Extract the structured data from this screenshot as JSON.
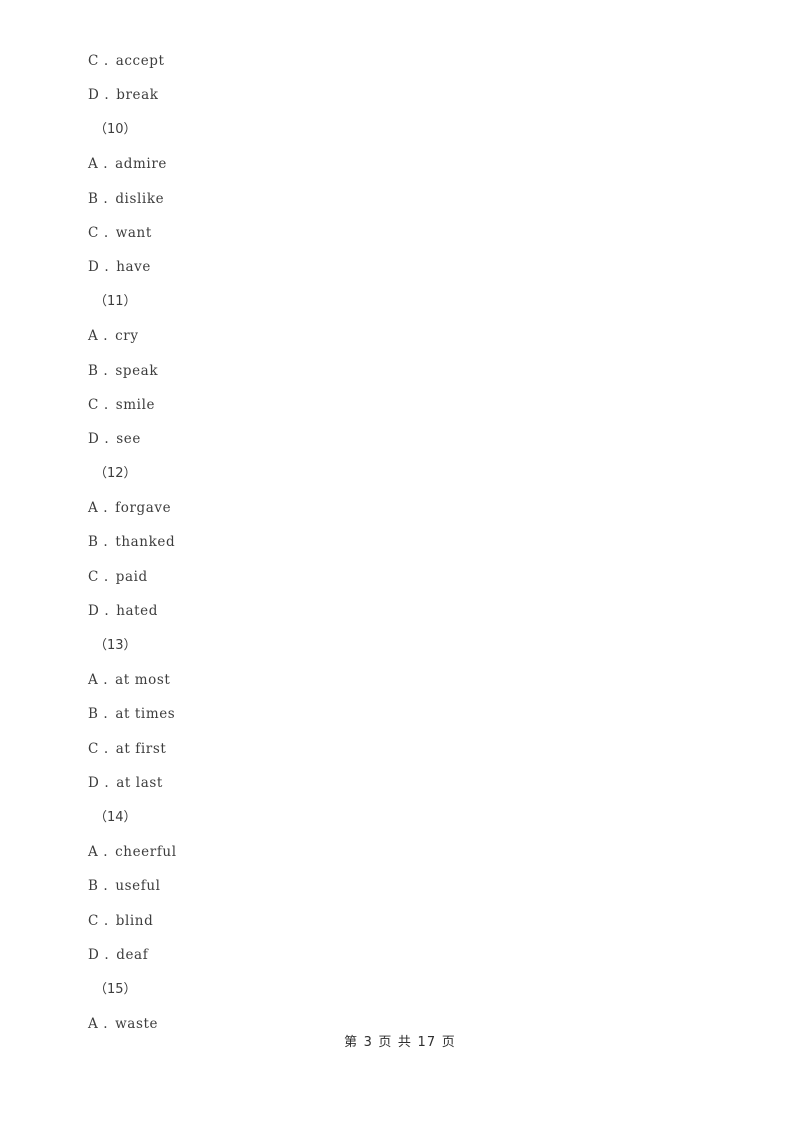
{
  "document": {
    "background_color": "#ffffff",
    "text_color": "#3d3d3d",
    "footer_color": "#2f2f2f"
  },
  "lines": [
    {
      "kind": "option",
      "letter": "C .",
      "text": "accept"
    },
    {
      "kind": "option",
      "letter": "D .",
      "text": "break"
    },
    {
      "kind": "qnum",
      "text": "（10）"
    },
    {
      "kind": "option",
      "letter": "A .",
      "text": "admire"
    },
    {
      "kind": "option",
      "letter": "B .",
      "text": "dislike"
    },
    {
      "kind": "option",
      "letter": "C .",
      "text": "want"
    },
    {
      "kind": "option",
      "letter": "D .",
      "text": "have"
    },
    {
      "kind": "qnum",
      "text": "（11）"
    },
    {
      "kind": "option",
      "letter": "A .",
      "text": "cry"
    },
    {
      "kind": "option",
      "letter": "B .",
      "text": "speak"
    },
    {
      "kind": "option",
      "letter": "C .",
      "text": "smile"
    },
    {
      "kind": "option",
      "letter": "D .",
      "text": "see"
    },
    {
      "kind": "qnum",
      "text": "（12）"
    },
    {
      "kind": "option",
      "letter": "A .",
      "text": "forgave"
    },
    {
      "kind": "option",
      "letter": "B .",
      "text": "thanked"
    },
    {
      "kind": "option",
      "letter": "C .",
      "text": "paid"
    },
    {
      "kind": "option",
      "letter": "D .",
      "text": "hated"
    },
    {
      "kind": "qnum",
      "text": "（13）"
    },
    {
      "kind": "option",
      "letter": "A .",
      "text": "at most"
    },
    {
      "kind": "option",
      "letter": "B .",
      "text": "at times"
    },
    {
      "kind": "option",
      "letter": "C .",
      "text": "at first"
    },
    {
      "kind": "option",
      "letter": "D .",
      "text": "at last"
    },
    {
      "kind": "qnum",
      "text": "（14）"
    },
    {
      "kind": "option",
      "letter": "A .",
      "text": "cheerful"
    },
    {
      "kind": "option",
      "letter": "B .",
      "text": "useful"
    },
    {
      "kind": "option",
      "letter": "C .",
      "text": "blind"
    },
    {
      "kind": "option",
      "letter": "D .",
      "text": "deaf"
    },
    {
      "kind": "qnum",
      "text": "（15）"
    },
    {
      "kind": "option",
      "letter": "A .",
      "text": "waste"
    }
  ],
  "footer": {
    "text": "第 3 页 共 17 页",
    "current_page": "3",
    "total_pages": "17"
  }
}
